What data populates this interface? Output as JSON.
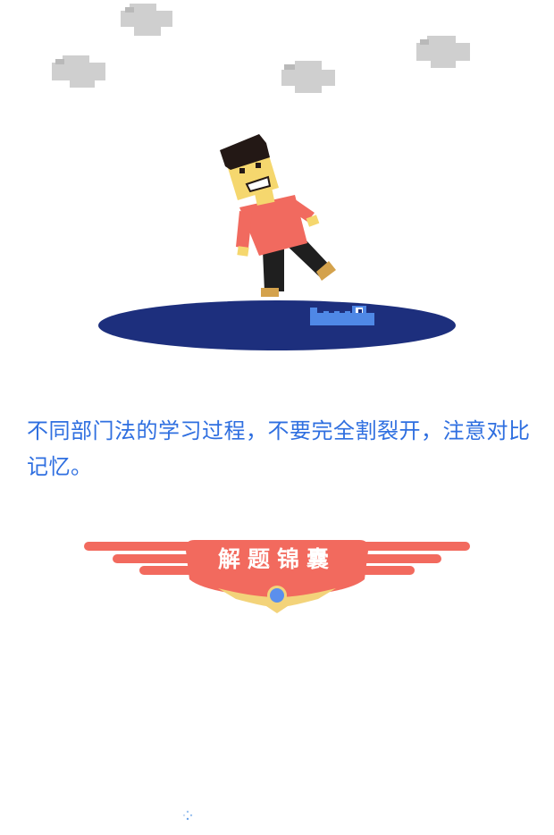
{
  "scene": {
    "illustration": "man-dancing-on-puddle-with-crocodile",
    "colors": {
      "cloud": "#cfcfcf",
      "cloud_shade": "#b9b9b9",
      "puddle": "#1d2f7d",
      "crocodile": "#4f88e6",
      "shirt": "#f16a5f",
      "skin": "#f5d76e",
      "hair": "#231815",
      "pants": "#1f1f1f",
      "shoes": "#d4a24c"
    }
  },
  "tip": {
    "text": "不同部门法的学习过程，不要完全割裂开，注意对比记忆。"
  },
  "badge": {
    "title": "解题锦囊",
    "colors": {
      "wings": "#f26a5e",
      "gold": "#f3d37a",
      "gem": "#5b8fec"
    }
  },
  "loader": {
    "icon": "loading-spinner-icon"
  }
}
